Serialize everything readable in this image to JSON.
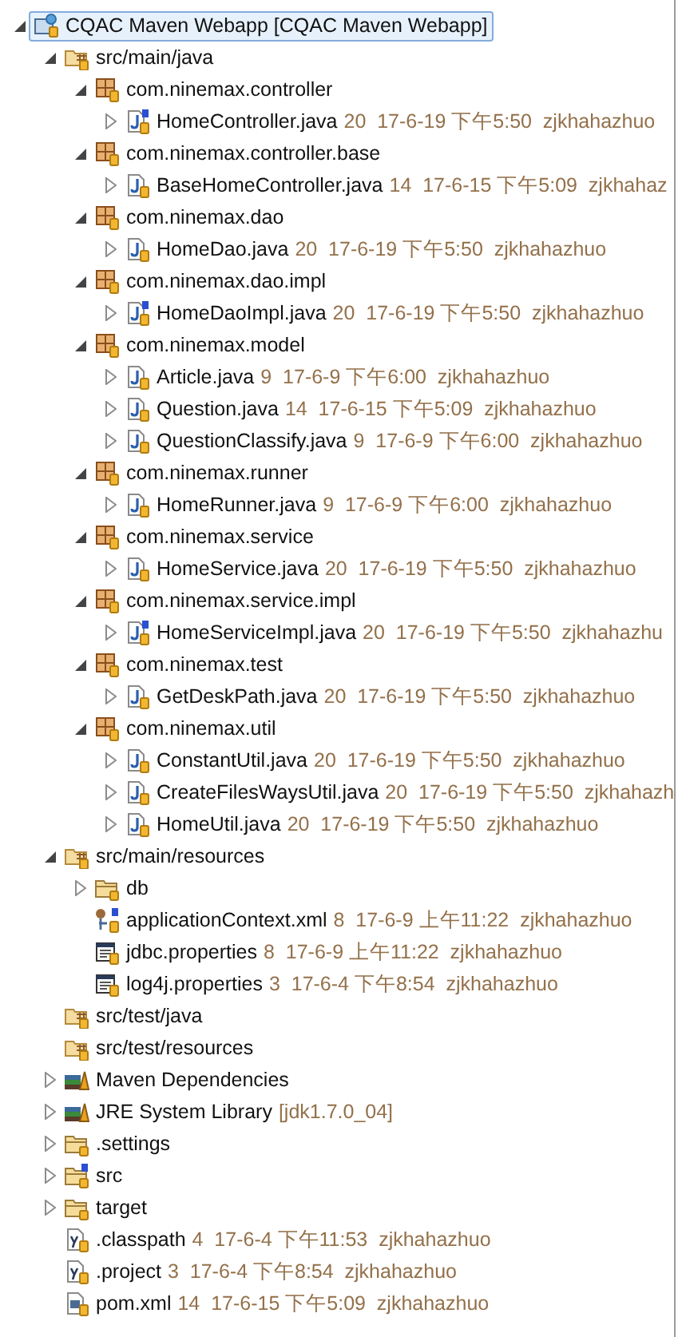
{
  "tree": [
    {
      "name": "CQAC Maven Webapp [CQAC Maven Webapp]",
      "kind": "project",
      "expanded": true,
      "selected": true,
      "children": [
        {
          "name": "src/main/java",
          "kind": "source-folder",
          "expanded": true,
          "selected": false,
          "children": [
            {
              "name": "com.ninemax.controller",
              "kind": "package",
              "expanded": true,
              "selected": false,
              "children": [
                {
                  "name": "HomeController.java",
                  "kind": "java-spring",
                  "expanded": false,
                  "selected": false,
                  "detail": "20  17-6-19 下午5:50  zjkhahazhuo"
                }
              ]
            },
            {
              "name": "com.ninemax.controller.base",
              "kind": "package",
              "expanded": true,
              "selected": false,
              "children": [
                {
                  "name": "BaseHomeController.java",
                  "kind": "java",
                  "expanded": false,
                  "selected": false,
                  "detail": "14  17-6-15 下午5:09  zjkhahaz"
                }
              ]
            },
            {
              "name": "com.ninemax.dao",
              "kind": "package",
              "expanded": true,
              "selected": false,
              "children": [
                {
                  "name": "HomeDao.java",
                  "kind": "java",
                  "expanded": false,
                  "selected": false,
                  "detail": "20  17-6-19 下午5:50  zjkhahazhuo"
                }
              ]
            },
            {
              "name": "com.ninemax.dao.impl",
              "kind": "package",
              "expanded": true,
              "selected": false,
              "children": [
                {
                  "name": "HomeDaoImpl.java",
                  "kind": "java-spring",
                  "expanded": false,
                  "selected": false,
                  "detail": "20  17-6-19 下午5:50  zjkhahazhuo"
                }
              ]
            },
            {
              "name": "com.ninemax.model",
              "kind": "package",
              "expanded": true,
              "selected": false,
              "children": [
                {
                  "name": "Article.java",
                  "kind": "java",
                  "expanded": false,
                  "selected": false,
                  "detail": "9  17-6-9 下午6:00  zjkhahazhuo"
                },
                {
                  "name": "Question.java",
                  "kind": "java",
                  "expanded": false,
                  "selected": false,
                  "detail": "14  17-6-15 下午5:09  zjkhahazhuo"
                },
                {
                  "name": "QuestionClassify.java",
                  "kind": "java",
                  "expanded": false,
                  "selected": false,
                  "detail": "9  17-6-9 下午6:00  zjkhahazhuo"
                }
              ]
            },
            {
              "name": "com.ninemax.runner",
              "kind": "package",
              "expanded": true,
              "selected": false,
              "children": [
                {
                  "name": "HomeRunner.java",
                  "kind": "java",
                  "expanded": false,
                  "selected": false,
                  "detail": "9  17-6-9 下午6:00  zjkhahazhuo"
                }
              ]
            },
            {
              "name": "com.ninemax.service",
              "kind": "package",
              "expanded": true,
              "selected": false,
              "children": [
                {
                  "name": "HomeService.java",
                  "kind": "java",
                  "expanded": false,
                  "selected": false,
                  "detail": "20  17-6-19 下午5:50  zjkhahazhuo"
                }
              ]
            },
            {
              "name": "com.ninemax.service.impl",
              "kind": "package",
              "expanded": true,
              "selected": false,
              "children": [
                {
                  "name": "HomeServiceImpl.java",
                  "kind": "java-spring",
                  "expanded": false,
                  "selected": false,
                  "detail": "20  17-6-19 下午5:50  zjkhahazhu"
                }
              ]
            },
            {
              "name": "com.ninemax.test",
              "kind": "package",
              "expanded": true,
              "selected": false,
              "children": [
                {
                  "name": "GetDeskPath.java",
                  "kind": "java",
                  "expanded": false,
                  "selected": false,
                  "detail": "20  17-6-19 下午5:50  zjkhahazhuo"
                }
              ]
            },
            {
              "name": "com.ninemax.util",
              "kind": "package",
              "expanded": true,
              "selected": false,
              "children": [
                {
                  "name": "ConstantUtil.java",
                  "kind": "java",
                  "expanded": false,
                  "selected": false,
                  "detail": "20  17-6-19 下午5:50  zjkhahazhuo"
                },
                {
                  "name": "CreateFilesWaysUtil.java",
                  "kind": "java",
                  "expanded": false,
                  "selected": false,
                  "detail": "20  17-6-19 下午5:50  zjkhahazh"
                },
                {
                  "name": "HomeUtil.java",
                  "kind": "java",
                  "expanded": false,
                  "selected": false,
                  "detail": "20  17-6-19 下午5:50  zjkhahazhuo"
                }
              ]
            }
          ]
        },
        {
          "name": "src/main/resources",
          "kind": "source-folder",
          "expanded": true,
          "selected": false,
          "children": [
            {
              "name": "db",
              "kind": "folder",
              "expanded": false,
              "selected": false
            },
            {
              "name": "applicationContext.xml",
              "kind": "xml-spring",
              "selected": false,
              "detail": "8  17-6-9 上午11:22  zjkhahazhuo"
            },
            {
              "name": "jdbc.properties",
              "kind": "properties",
              "selected": false,
              "detail": "8  17-6-9 上午11:22  zjkhahazhuo"
            },
            {
              "name": "log4j.properties",
              "kind": "properties",
              "selected": false,
              "detail": "3  17-6-4 下午8:54  zjkhahazhuo"
            }
          ]
        },
        {
          "name": "src/test/java",
          "kind": "source-folder",
          "selected": false
        },
        {
          "name": "src/test/resources",
          "kind": "source-folder",
          "selected": false
        },
        {
          "name": "Maven Dependencies",
          "kind": "library",
          "expanded": false,
          "selected": false
        },
        {
          "name": "JRE System Library",
          "kind": "library",
          "expanded": false,
          "selected": false,
          "detail": "[jdk1.7.0_04]"
        },
        {
          "name": ".settings",
          "kind": "folder",
          "expanded": false,
          "selected": false
        },
        {
          "name": "src",
          "kind": "folder-spring",
          "expanded": false,
          "selected": false
        },
        {
          "name": "target",
          "kind": "folder",
          "expanded": false,
          "selected": false
        },
        {
          "name": ".classpath",
          "kind": "text-file",
          "selected": false,
          "detail": "4  17-6-4 下午11:53  zjkhahazhuo"
        },
        {
          "name": ".project",
          "kind": "text-file",
          "selected": false,
          "detail": "3  17-6-4 下午8:54  zjkhahazhuo"
        },
        {
          "name": "pom.xml",
          "kind": "pom",
          "selected": false,
          "detail": "14  17-6-15 下午5:09  zjkhahazhuo"
        }
      ]
    }
  ]
}
